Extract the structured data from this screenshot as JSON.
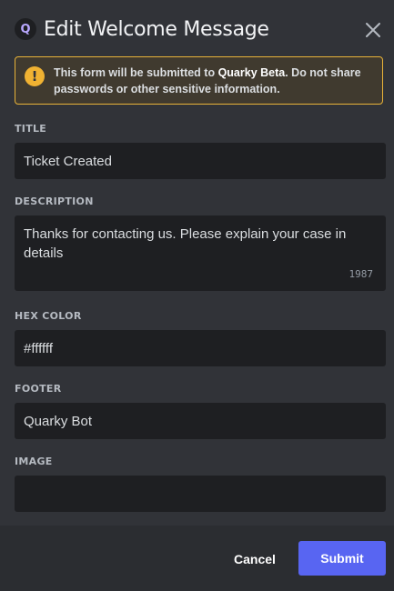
{
  "header": {
    "app_icon_letter": "Q",
    "title": "Edit Welcome Message",
    "close_icon": "close-icon"
  },
  "notice": {
    "text_before": "This form will be submitted to ",
    "app_name": "Quarky Beta",
    "text_after": ". Do not share passwords or other sensitive information.",
    "icon": "exclamation-icon",
    "accent_color": "#f0b232"
  },
  "fields": {
    "title": {
      "label": "TITLE",
      "value": "Ticket Created"
    },
    "description": {
      "label": "DESCRIPTION",
      "value": "Thanks for contacting us. Please explain your case in details",
      "remaining": "1987"
    },
    "hex_color": {
      "label": "HEX COLOR",
      "value": "#ffffff"
    },
    "footer": {
      "label": "FOOTER",
      "value": "Quarky Bot"
    },
    "image": {
      "label": "IMAGE",
      "value": ""
    }
  },
  "actions": {
    "cancel_label": "Cancel",
    "submit_label": "Submit",
    "submit_color": "#5865f2"
  }
}
